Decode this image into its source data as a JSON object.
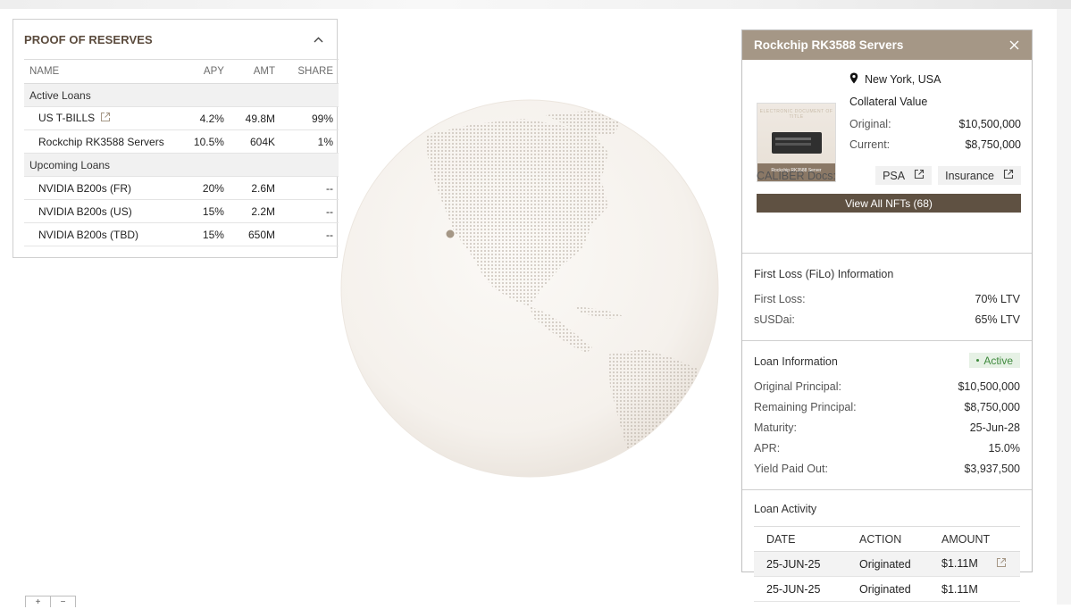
{
  "reserves": {
    "title": "PROOF OF RESERVES",
    "columns": [
      "NAME",
      "APY",
      "AMT",
      "SHARE"
    ],
    "groups": [
      {
        "label": "Active Loans",
        "rows": [
          {
            "name": "US T-BILLS",
            "apy": "4.2%",
            "amt": "49.8M",
            "share": "99%",
            "link_icon": "external-link-icon"
          },
          {
            "name": "Rockchip RK3588 Servers",
            "apy": "10.5%",
            "amt": "604K",
            "share": "1%"
          }
        ]
      },
      {
        "label": "Upcoming Loans",
        "rows": [
          {
            "name": "NVIDIA B200s (FR)",
            "apy": "20%",
            "amt": "2.6M",
            "share": "--"
          },
          {
            "name": "NVIDIA B200s (US)",
            "apy": "15%",
            "amt": "2.2M",
            "share": "--"
          },
          {
            "name": "NVIDIA B200s (TBD)",
            "apy": "15%",
            "amt": "650M",
            "share": "--"
          }
        ]
      }
    ]
  },
  "detail": {
    "title": "Rockchip RK3588 Servers",
    "thumb": {
      "top_text": "ELECTRONIC DOCUMENT OF TITLE",
      "caption": "Rockchip RK3588 Server"
    },
    "location": "New York, USA",
    "collateral_label": "Collateral Value",
    "original_label": "Original:",
    "original_value": "$10,500,000",
    "current_label": "Current:",
    "current_value": "$8,750,000",
    "docs_label": "CALIBER Docs:",
    "doc_psa": "PSA",
    "doc_insurance": "Insurance",
    "view_all": "View All NFTs (68)",
    "first_loss": {
      "title": "First Loss (FiLo)  Information",
      "rows": [
        {
          "k": "First Loss:",
          "v": "70% LTV"
        },
        {
          "k": "sUSDai:",
          "v": "65% LTV"
        }
      ]
    },
    "loan": {
      "title": "Loan  Information",
      "status": "Active",
      "rows": [
        {
          "k": "Original Principal:",
          "v": "$10,500,000"
        },
        {
          "k": "Remaining Principal:",
          "v": "$8,750,000"
        },
        {
          "k": "Maturity:",
          "v": "25-Jun-28"
        },
        {
          "k": "APR:",
          "v": "15.0%"
        },
        {
          "k": "Yield Paid Out:",
          "v": "$3,937,500"
        }
      ]
    },
    "activity": {
      "title": "Loan Activity",
      "columns": [
        "DATE",
        "ACTION",
        "AMOUNT"
      ],
      "rows": [
        {
          "date": "25-JUN-25",
          "action": "Originated",
          "amount": "$1.11M"
        },
        {
          "date": "25-JUN-25",
          "action": "Originated",
          "amount": "$1.11M"
        }
      ]
    }
  },
  "colors": {
    "accent": "#a59786",
    "button": "#5f5142",
    "title": "#5a4a3c",
    "active": "#3f8a3d",
    "marker": "#a59786"
  },
  "zoom": {
    "plus": "+",
    "minus": "−"
  }
}
